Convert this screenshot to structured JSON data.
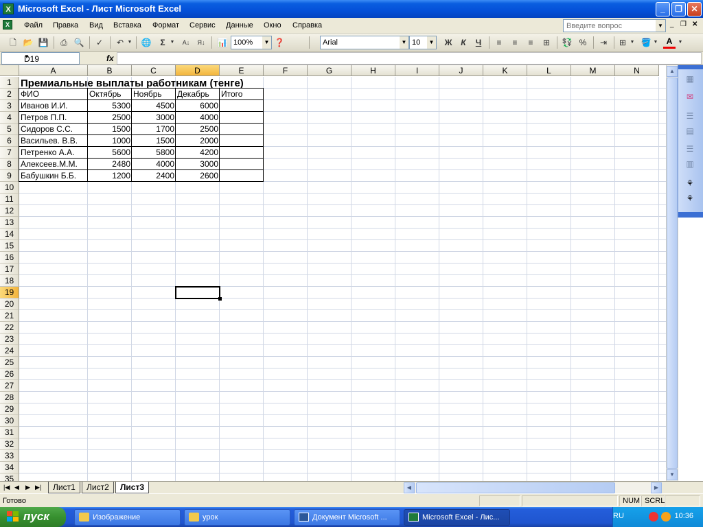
{
  "window": {
    "title": "Microsoft Excel - Лист Microsoft Excel"
  },
  "menu": {
    "items": [
      "Файл",
      "Правка",
      "Вид",
      "Вставка",
      "Формат",
      "Сервис",
      "Данные",
      "Окно",
      "Справка"
    ],
    "help_placeholder": "Введите вопрос"
  },
  "toolbar": {
    "zoom": "100%",
    "font": "Arial",
    "font_size": "10"
  },
  "formula_bar": {
    "name_box": "D19",
    "fx": "fx",
    "formula": ""
  },
  "grid": {
    "columns": [
      "A",
      "B",
      "C",
      "D",
      "E",
      "F",
      "G",
      "H",
      "I",
      "J",
      "K",
      "L",
      "M",
      "N"
    ],
    "selected_column": "D",
    "selected_row": 19,
    "row_count": 35
  },
  "sheet": {
    "title": "Премиальные выплаты работникам (тенге)",
    "headers": [
      "ФИО",
      "Октябрь",
      "Ноябрь",
      "Декабрь",
      "Итого"
    ],
    "rows": [
      [
        "Иванов И.И.",
        "5300",
        "4500",
        "6000",
        ""
      ],
      [
        "Петров П.П.",
        "2500",
        "3000",
        "4000",
        ""
      ],
      [
        "Сидоров С.С.",
        "1500",
        "1700",
        "2500",
        ""
      ],
      [
        "Васильев. В.В.",
        "1000",
        "1500",
        "2000",
        ""
      ],
      [
        "Петренко А.А.",
        "5600",
        "5800",
        "4200",
        ""
      ],
      [
        "Алексеев.М.М.",
        "2480",
        "4000",
        "3000",
        ""
      ],
      [
        "Бабушкин Б.Б.",
        "1200",
        "2400",
        "2600",
        ""
      ]
    ]
  },
  "tabs": {
    "items": [
      "Лист1",
      "Лист2",
      "Лист3"
    ],
    "active": "Лист3"
  },
  "status": {
    "text": "Готово",
    "num": "NUM",
    "scrl": "SCRL"
  },
  "taskbar": {
    "start": "пуск",
    "tasks": [
      "Изображение",
      "урок",
      "Документ Microsoft ...",
      "Microsoft Excel - Лис..."
    ],
    "active_task": 3,
    "lang": "RU",
    "clock": "10:36"
  },
  "colors": {
    "accent": "#0a5ee0",
    "selection_header": "#f3b43c",
    "taskbar": "#245edb",
    "start": "#37902f"
  }
}
